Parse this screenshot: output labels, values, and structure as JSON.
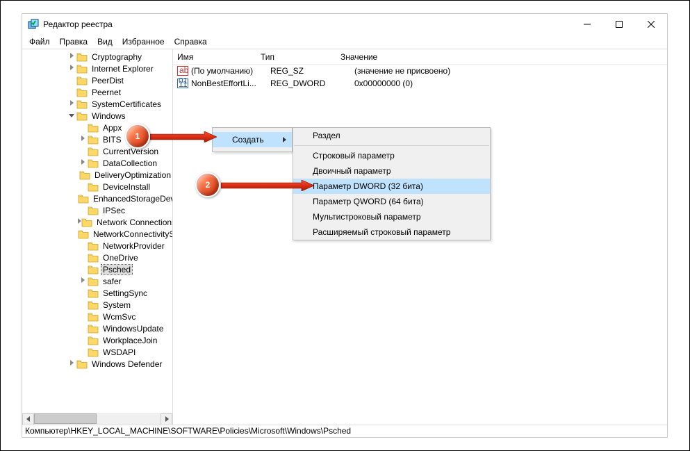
{
  "window": {
    "title": "Редактор реестра"
  },
  "menu": {
    "file": "Файл",
    "edit": "Правка",
    "view": "Вид",
    "favorites": "Избранное",
    "help": "Справка"
  },
  "tree": {
    "items": [
      {
        "indent": 4,
        "exp": "right",
        "label": "Cryptography"
      },
      {
        "indent": 4,
        "exp": "right",
        "label": "Internet Explorer"
      },
      {
        "indent": 4,
        "exp": "",
        "label": "PeerDist"
      },
      {
        "indent": 4,
        "exp": "",
        "label": "Peernet"
      },
      {
        "indent": 4,
        "exp": "right",
        "label": "SystemCertificates"
      },
      {
        "indent": 4,
        "exp": "down",
        "label": "Windows"
      },
      {
        "indent": 5,
        "exp": "",
        "label": "Appx"
      },
      {
        "indent": 5,
        "exp": "right",
        "label": "BITS"
      },
      {
        "indent": 5,
        "exp": "",
        "label": "CurrentVersion"
      },
      {
        "indent": 5,
        "exp": "right",
        "label": "DataCollection"
      },
      {
        "indent": 5,
        "exp": "",
        "label": "DeliveryOptimization"
      },
      {
        "indent": 5,
        "exp": "",
        "label": "DeviceInstall"
      },
      {
        "indent": 5,
        "exp": "",
        "label": "EnhancedStorageDevices"
      },
      {
        "indent": 5,
        "exp": "",
        "label": "IPSec"
      },
      {
        "indent": 5,
        "exp": "right",
        "label": "Network Connections"
      },
      {
        "indent": 5,
        "exp": "",
        "label": "NetworkConnectivityStatusIndicator"
      },
      {
        "indent": 5,
        "exp": "",
        "label": "NetworkProvider"
      },
      {
        "indent": 5,
        "exp": "",
        "label": "OneDrive"
      },
      {
        "indent": 5,
        "exp": "",
        "label": "Psched",
        "selected": true
      },
      {
        "indent": 5,
        "exp": "right",
        "label": "safer"
      },
      {
        "indent": 5,
        "exp": "",
        "label": "SettingSync"
      },
      {
        "indent": 5,
        "exp": "",
        "label": "System"
      },
      {
        "indent": 5,
        "exp": "",
        "label": "WcmSvc"
      },
      {
        "indent": 5,
        "exp": "",
        "label": "WindowsUpdate"
      },
      {
        "indent": 5,
        "exp": "",
        "label": "WorkplaceJoin"
      },
      {
        "indent": 5,
        "exp": "",
        "label": "WSDAPI"
      },
      {
        "indent": 4,
        "exp": "right",
        "label": "Windows Defender"
      }
    ]
  },
  "list": {
    "headers": {
      "name": "Имя",
      "type": "Тип",
      "value": "Значение"
    },
    "rows": [
      {
        "icon": "sz",
        "name": "(По умолчанию)",
        "type": "REG_SZ",
        "value": "(значение не присвоено)"
      },
      {
        "icon": "bin",
        "name": "NonBestEffortLi...",
        "type": "REG_DWORD",
        "value": "0x00000000 (0)"
      }
    ]
  },
  "context": {
    "main": {
      "create": "Создать"
    },
    "sub": {
      "key": "Раздел",
      "string": "Строковый параметр",
      "binary": "Двоичный параметр",
      "dword": "Параметр DWORD (32 бита)",
      "qword": "Параметр QWORD (64 бита)",
      "multi": "Мультистроковый параметр",
      "expand": "Расширяемый строковый параметр"
    }
  },
  "statusbar": {
    "path": "Компьютер\\HKEY_LOCAL_MACHINE\\SOFTWARE\\Policies\\Microsoft\\Windows\\Psched"
  },
  "annotations": {
    "b1": "1",
    "b2": "2"
  }
}
